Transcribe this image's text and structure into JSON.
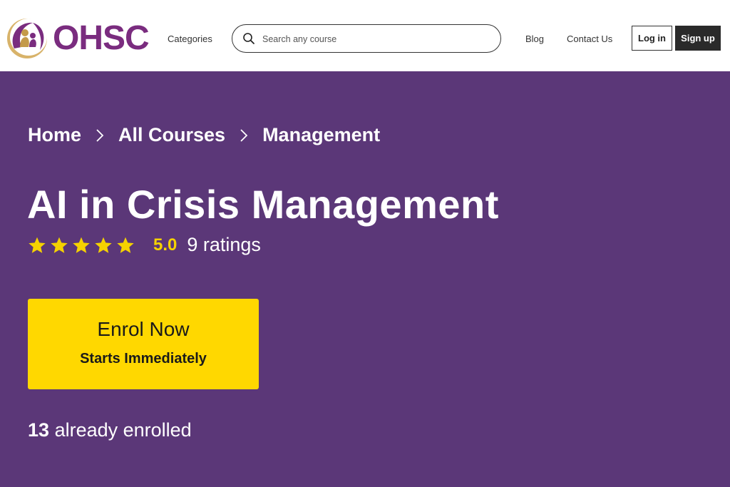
{
  "header": {
    "logo_text": "OHSC",
    "nav_categories": "Categories",
    "search_placeholder": "Search any course",
    "nav_blog": "Blog",
    "nav_contact": "Contact Us",
    "login_label": "Log in",
    "signup_label": "Sign up"
  },
  "breadcrumb": {
    "items": [
      "Home",
      "All Courses",
      "Management"
    ]
  },
  "course": {
    "title": "AI in Crisis Management",
    "rating_stars": 5,
    "rating_value": "5.0",
    "rating_count": "9 ratings",
    "enrol_label": "Enrol Now",
    "enrol_sub": "Starts Immediately",
    "enrolled_count": "13",
    "enrolled_text": "already enrolled"
  },
  "colors": {
    "hero_bg": "#5b3778",
    "brand_purple": "#7a2c7f",
    "cta_yellow": "#ffd800",
    "star_yellow": "#f5d200"
  }
}
